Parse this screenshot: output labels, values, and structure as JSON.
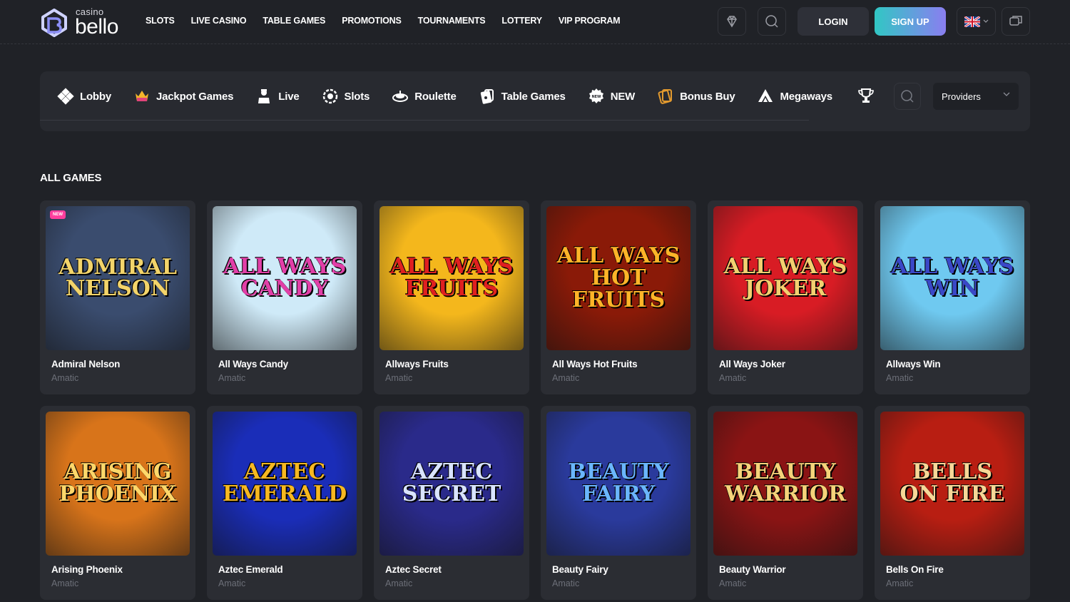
{
  "logo": {
    "small": "casino",
    "big": "bello"
  },
  "topnav": [
    "SLOTS",
    "LIVE CASINO",
    "TABLE GAMES",
    "PROMOTIONS",
    "TOURNAMENTS",
    "LOTTERY",
    "VIP PROGRAM"
  ],
  "header": {
    "login": "LOGIN",
    "signup": "SIGN UP"
  },
  "categories": [
    "Lobby",
    "Jackpot Games",
    "Live",
    "Slots",
    "Roulette",
    "Table Games",
    "NEW",
    "Bonus Buy",
    "Megaways"
  ],
  "providers_label": "Providers",
  "section_title": "ALL GAMES",
  "badge_new": "NEW",
  "games": [
    {
      "name": "Admiral Nelson",
      "provider": "Amatic",
      "art": [
        "Admiral Nelson",
        ""
      ],
      "bg": "#3a4c6e",
      "fg": "#f3d46a"
    },
    {
      "name": "All Ways Candy",
      "provider": "Amatic",
      "art": [
        "All Ways",
        "Candy"
      ],
      "bg": "#cfeaf8",
      "fg": "#e23fa8"
    },
    {
      "name": "Allways Fruits",
      "provider": "Amatic",
      "art": [
        "All Ways",
        "Fruits"
      ],
      "bg": "#f4b71c",
      "fg": "#e02020"
    },
    {
      "name": "All Ways Hot Fruits",
      "provider": "Amatic",
      "art": [
        "All Ways",
        "Hot Fruits"
      ],
      "bg": "#8a1a08",
      "fg": "#ffb428"
    },
    {
      "name": "All Ways Joker",
      "provider": "Amatic",
      "art": [
        "All Ways",
        "Joker"
      ],
      "bg": "#d81c24",
      "fg": "#f3d070"
    },
    {
      "name": "Allways Win",
      "provider": "Amatic",
      "art": [
        "All Ways",
        "Win"
      ],
      "bg": "#6fc9f0",
      "fg": "#3a48c8"
    },
    {
      "name": "Arising Phoenix",
      "provider": "Amatic",
      "art": [
        "Arising",
        "Phoenix"
      ],
      "bg": "#d8741a",
      "fg": "#ffd76a"
    },
    {
      "name": "Aztec Emerald",
      "provider": "Amatic",
      "art": [
        "Aztec",
        "Emerald"
      ],
      "bg": "#1a2db8",
      "fg": "#f6b820"
    },
    {
      "name": "Aztec Secret",
      "provider": "Amatic",
      "art": [
        "Aztec",
        "Secret"
      ],
      "bg": "#2a2a8a",
      "fg": "#d9e4ff"
    },
    {
      "name": "Beauty Fairy",
      "provider": "Amatic",
      "art": [
        "Beauty",
        "Fairy"
      ],
      "bg": "#2a3a9c",
      "fg": "#6ab6ff"
    },
    {
      "name": "Beauty Warrior",
      "provider": "Amatic",
      "art": [
        "Beauty",
        "Warrior"
      ],
      "bg": "#8a1414",
      "fg": "#f5d37a"
    },
    {
      "name": "Bells On Fire",
      "provider": "Amatic",
      "art": [
        "Bells",
        "On Fire"
      ],
      "bg": "#b81e12",
      "fg": "#f7d798"
    }
  ]
}
